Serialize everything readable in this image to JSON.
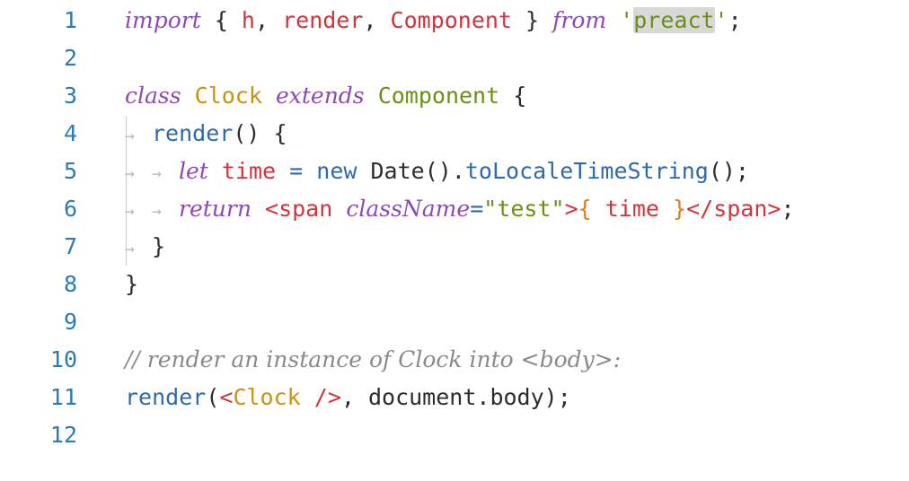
{
  "line_numbers": [
    "1",
    "2",
    "3",
    "4",
    "5",
    "6",
    "7",
    "8",
    "9",
    "10",
    "11",
    "12"
  ],
  "colors": {
    "keyword": "#8c4bb4",
    "function": "#2f6aa8",
    "class_name": "#c79412",
    "component": "#6a9018",
    "identifier": "#d1343d",
    "string": "#6a9018",
    "comment": "#8a8a8a",
    "line_number": "#2b7bb5",
    "highlight": "#d8d8d8"
  },
  "code": {
    "l1": {
      "kw_import": "import",
      "brace_open": " { ",
      "id_h": "h",
      "comma1": ", ",
      "id_render": "render",
      "comma2": ", ",
      "id_component": "Component",
      "brace_close": " } ",
      "kw_from": "from",
      "space": " ",
      "quote_open": "'",
      "str_preact": "preact",
      "quote_close": "'",
      "semi": ";"
    },
    "l3": {
      "kw_class": "class",
      "space1": " ",
      "cls_clock": "Clock",
      "space2": " ",
      "kw_extends": "extends",
      "space3": " ",
      "cmp_component": "Component",
      "brace": " {"
    },
    "l4": {
      "arrow": "→",
      "fn_render": "render",
      "rest": "() {"
    },
    "l5": {
      "arrow1": "→",
      "arrow2": "→",
      "kw_let": "let",
      "space1": " ",
      "id_time": "time",
      "eq": " = ",
      "op_new": "new",
      "space2": " ",
      "date": "Date()",
      "dot": ".",
      "fn_tolocale": "toLocaleTimeString",
      "rest": "();"
    },
    "l6": {
      "arrow1": "→",
      "arrow2": "→",
      "kw_return": "return",
      "space1": " ",
      "tag_open": "<span",
      "space2": " ",
      "kw_classname": "className",
      "eq": "=",
      "str_test": "\"test\"",
      "tag_gt": ">",
      "brace_o": "{",
      "space3": " ",
      "id_time": "time",
      "space4": " ",
      "brace_c": "}",
      "tag_close": "</span>",
      "semi": ";"
    },
    "l7": {
      "arrow": "→",
      "brace": "}"
    },
    "l8": {
      "brace": "}"
    },
    "l10": {
      "comment": "// render an instance of Clock into <body>:"
    },
    "l11": {
      "fn_render": "render",
      "paren": "(",
      "tag_lt": "<",
      "cls_clock": "Clock",
      "space": " ",
      "tag_selfclose": "/>",
      "rest": ", document.body);"
    }
  }
}
